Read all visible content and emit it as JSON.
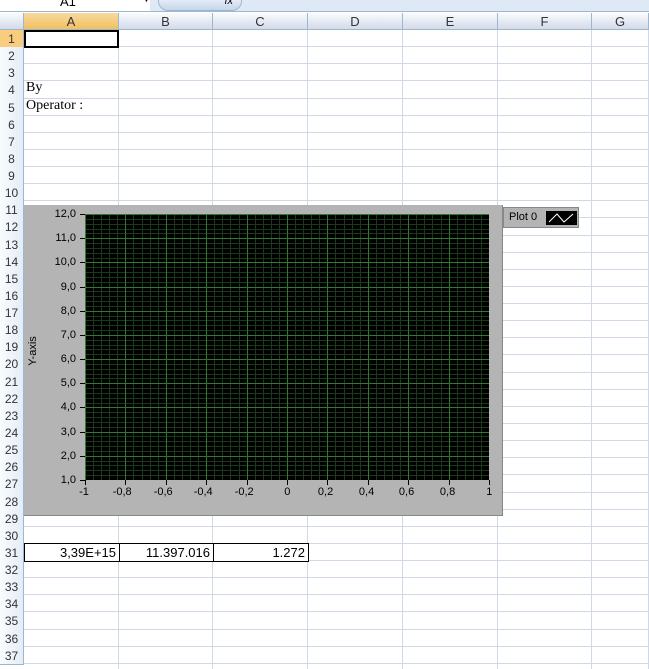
{
  "formula_bar": {
    "name_box": "A1",
    "fx_label": "fx"
  },
  "columns": [
    "A",
    "B",
    "C",
    "D",
    "E",
    "F",
    "G"
  ],
  "rows": 37,
  "selected_cell": "A1",
  "cells": {
    "a4": "By",
    "a5": "Operator :",
    "a31": "3,39E+15",
    "b31": "11.397.016",
    "c31": "1.272"
  },
  "chart_data": {
    "type": "line",
    "title": "",
    "xlabel": "",
    "ylabel": "Y-axis",
    "xlim": [
      -1,
      1
    ],
    "ylim": [
      1,
      12
    ],
    "x_ticks": [
      "-1",
      "-0,8",
      "-0,6",
      "-0,4",
      "-0,2",
      "0",
      "0,2",
      "0,4",
      "0,6",
      "0,8",
      "1"
    ],
    "y_ticks": [
      "1,0",
      "2,0",
      "3,0",
      "4,0",
      "5,0",
      "6,0",
      "7,0",
      "8,0",
      "9,0",
      "10,0",
      "11,0",
      "12,0"
    ],
    "grid": true,
    "series": [
      {
        "name": "Plot 0",
        "x": [],
        "y": []
      }
    ],
    "legend": "top-right",
    "colors": {
      "background": "#000000",
      "grid_major": "#2f7a2f",
      "grid_minor": "#1a3a1a",
      "panel": "#b4b4b4"
    }
  }
}
